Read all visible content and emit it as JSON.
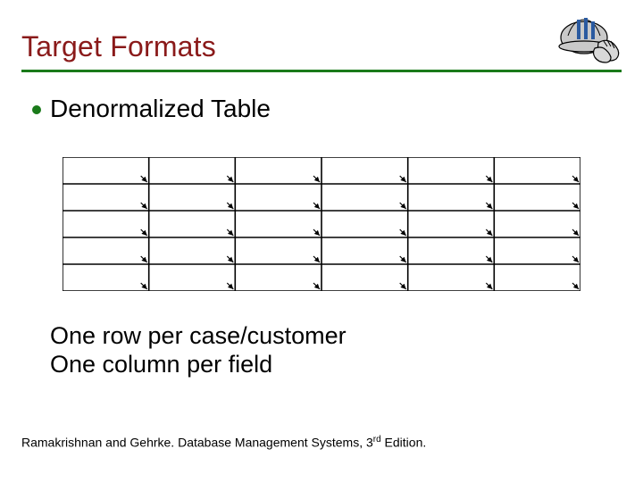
{
  "title": "Target Formats",
  "bullet": "Denormalized Table",
  "table": {
    "rows": 5,
    "cols": 6
  },
  "body_line1": "One row per case/customer",
  "body_line2": "One column per field",
  "footer_prefix": "Ramakrishnan and Gehrke. Database Management Systems, 3",
  "footer_sup": "rd",
  "footer_suffix": " Edition.",
  "icon": {
    "name": "hardhat-gloves-icon",
    "hat_color": "#c9c9c9",
    "hat_stripe": "#2a5aa0",
    "glove_color": "#d8d8d8",
    "outline": "#000000"
  }
}
